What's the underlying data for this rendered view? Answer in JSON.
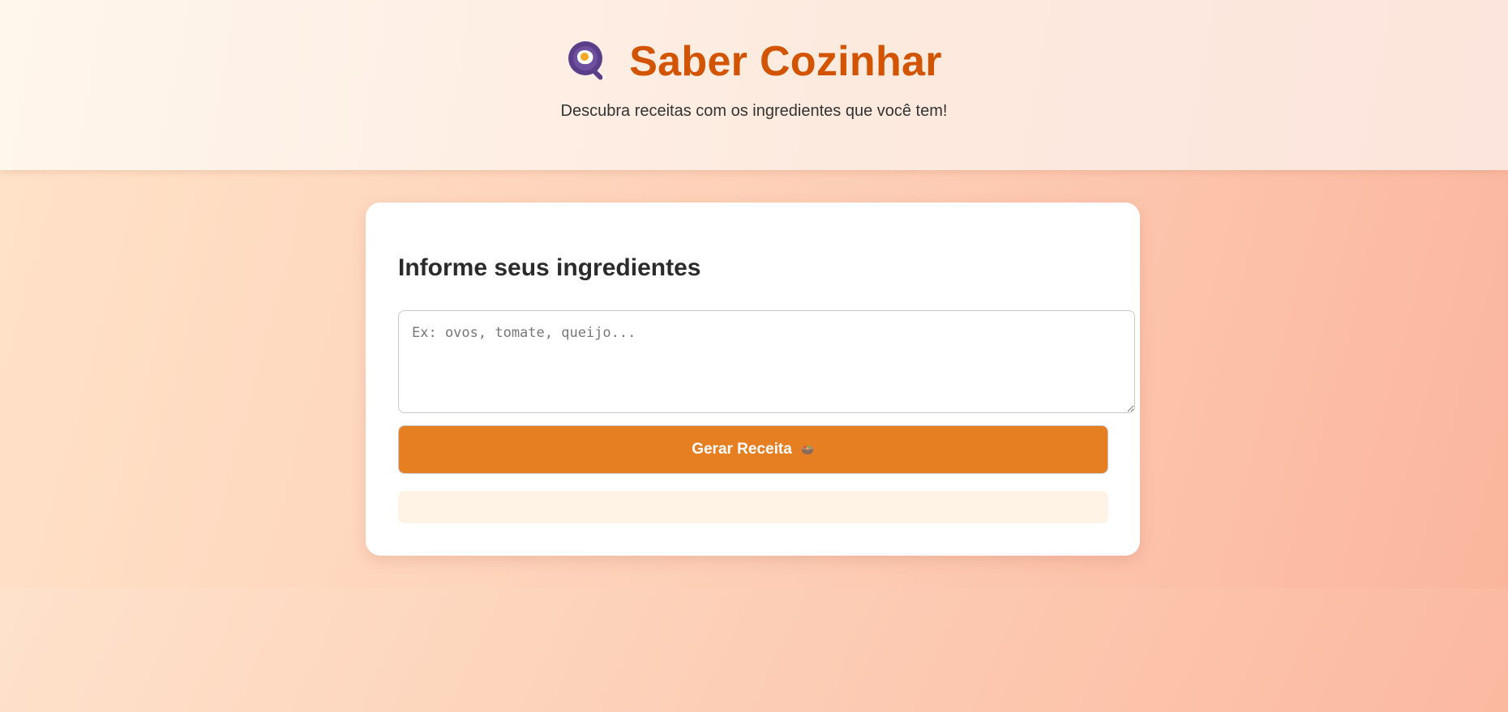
{
  "header": {
    "logo_icon": "frying-pan-egg-icon",
    "title": "Saber Cozinhar",
    "subtitle": "Descubra receitas com os ingredientes que você tem!"
  },
  "form": {
    "heading": "Informe seus ingredientes",
    "placeholder": "Ex: ovos, tomate, queijo...",
    "value": "",
    "button_label": "Gerar Receita",
    "button_icon": "cooking-pot-icon",
    "result_text": ""
  },
  "colors": {
    "title": "#d35400",
    "button": "#e67e22",
    "logo_pan": "#5b3e8a",
    "result_bg": "#fff3e6"
  }
}
